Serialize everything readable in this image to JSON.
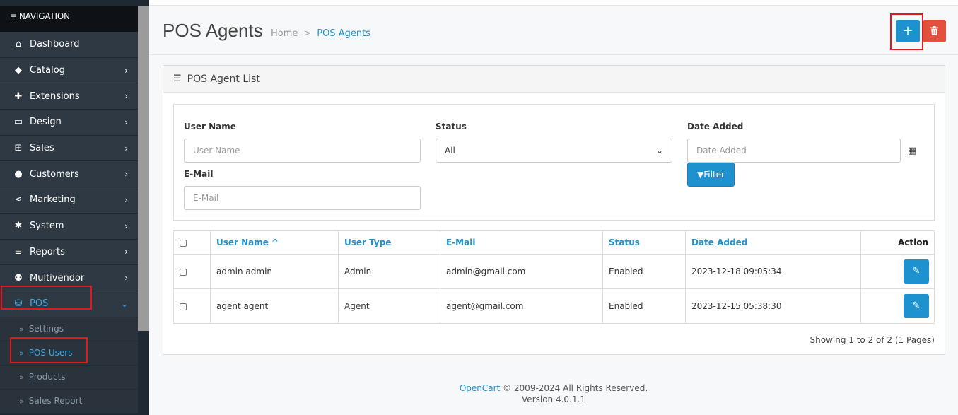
{
  "sidebar": {
    "header": "NAVIGATION",
    "items": [
      {
        "label": "Dashboard",
        "icon": "home-icon",
        "glyph": "⌂",
        "chevron": ""
      },
      {
        "label": "Catalog",
        "icon": "tag-icon",
        "glyph": "◆",
        "chevron": "›"
      },
      {
        "label": "Extensions",
        "icon": "puzzle-icon",
        "glyph": "✚",
        "chevron": "›"
      },
      {
        "label": "Design",
        "icon": "monitor-icon",
        "glyph": "▭",
        "chevron": "›"
      },
      {
        "label": "Sales",
        "icon": "cart-icon",
        "glyph": "⊞",
        "chevron": "›"
      },
      {
        "label": "Customers",
        "icon": "user-icon",
        "glyph": "●",
        "chevron": "›"
      },
      {
        "label": "Marketing",
        "icon": "share-icon",
        "glyph": "⋖",
        "chevron": "›"
      },
      {
        "label": "System",
        "icon": "gear-icon",
        "glyph": "✱",
        "chevron": "›"
      },
      {
        "label": "Reports",
        "icon": "bar-chart-icon",
        "glyph": "≡",
        "chevron": "›"
      },
      {
        "label": "Multivendor",
        "icon": "users-icon",
        "glyph": "⚉",
        "chevron": "›"
      },
      {
        "label": "POS",
        "icon": "basket-icon",
        "glyph": "⛁",
        "chevron": "⌄"
      }
    ],
    "pos_sub": [
      {
        "label": "Settings"
      },
      {
        "label": "POS Users"
      },
      {
        "label": "Products"
      },
      {
        "label": "Sales Report"
      }
    ]
  },
  "header": {
    "title": "POS Agents",
    "breadcrumb_home": "Home",
    "breadcrumb_sep": ">",
    "breadcrumb_current": "POS Agents",
    "add_label": "+",
    "delete_glyph": "🗑"
  },
  "card": {
    "title": "POS Agent List"
  },
  "filter": {
    "username_label": "User Name",
    "username_placeholder": "User Name",
    "email_label": "E-Mail",
    "email_placeholder": "E-Mail",
    "status_label": "Status",
    "status_value": "All",
    "date_label": "Date Added",
    "date_placeholder": "Date Added",
    "filter_button": "Filter"
  },
  "table": {
    "headers": {
      "username": "User Name ^",
      "usertype": "User Type",
      "email": "E-Mail",
      "status": "Status",
      "date": "Date Added",
      "action": "Action"
    },
    "rows": [
      {
        "username": "admin admin",
        "usertype": "Admin",
        "email": "admin@gmail.com",
        "status": "Enabled",
        "date": "2023-12-18 09:05:34"
      },
      {
        "username": "agent agent",
        "usertype": "Agent",
        "email": "agent@gmail.com",
        "status": "Enabled",
        "date": "2023-12-15 05:38:30"
      }
    ],
    "showing": "Showing 1 to 2 of 2 (1 Pages)"
  },
  "footer": {
    "brand": "OpenCart",
    "copyright": "© 2009-2024 All Rights Reserved.",
    "version": "Version 4.0.1.1"
  },
  "colors": {
    "primary": "#1e91cf",
    "danger": "#e3503e",
    "highlight_box": "#e4161e",
    "sidebar_bg": "#2e3944"
  }
}
